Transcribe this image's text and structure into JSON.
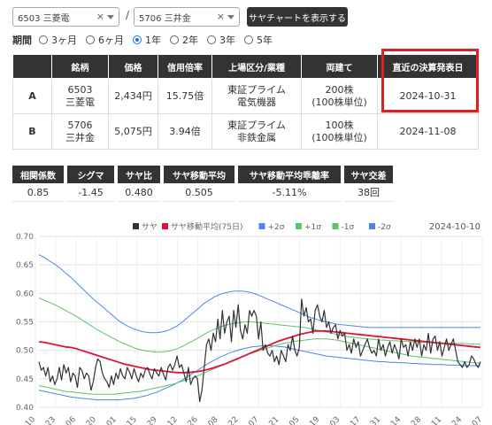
{
  "header": {
    "stock1": "6503 三菱電",
    "stock2": "5706 三井金",
    "slash": "/",
    "clear_icon": "×",
    "show_button": "サヤチャートを表示する"
  },
  "period": {
    "label": "期間",
    "options": [
      "3ヶ月",
      "6ヶ月",
      "1年",
      "2年",
      "3年",
      "5年"
    ],
    "selected": "1年"
  },
  "stock_table": {
    "headers": [
      "",
      "銘柄",
      "価格",
      "信用倍率",
      "上場区分/業種",
      "両建て",
      "直近の決算発表日"
    ],
    "rows": [
      {
        "id": "A",
        "name1": "6503",
        "name2": "三菱電",
        "price": "2,434円",
        "margin": "15.75倍",
        "market1": "東証プライム",
        "market2": "電気機器",
        "unit1": "200株",
        "unit2": "(100株単位)",
        "earnings": "2024-10-31"
      },
      {
        "id": "B",
        "name1": "5706",
        "name2": "三井金",
        "price": "5,075円",
        "margin": "3.94倍",
        "market1": "東証プライム",
        "market2": "非鉄金属",
        "unit1": "100株",
        "unit2": "(100株単位)",
        "earnings": "2024-11-08"
      }
    ]
  },
  "stats": {
    "headers": [
      "相関係数",
      "シグマ",
      "サヤ比",
      "サヤ移動平均",
      "サヤ移動平均乖離率",
      "サヤ交差"
    ],
    "values": [
      "0.85",
      "-1.45",
      "0.480",
      "0.505",
      "-5.11%",
      "38回"
    ]
  },
  "colors": {
    "saya": "#333333",
    "ma": "#e0103a",
    "sigma2": "#4d84f0",
    "sigma1": "#5cc46a",
    "highlight": "#e02020",
    "header_bg": "#333333"
  },
  "chart_data": {
    "type": "line",
    "date_label": "2024-10-10",
    "legend": [
      "サヤ",
      "サヤ移動平均(75日)",
      "+2σ",
      "+1σ",
      "-1σ",
      "-2σ"
    ],
    "ylim": [
      0.4,
      0.7
    ],
    "yticks": [
      "0.70",
      "0.65",
      "0.60",
      "0.55",
      "0.50",
      "0.45",
      "0.40"
    ],
    "xticks": [
      "10",
      "23",
      "06",
      "20",
      "01",
      "15",
      "29",
      "12",
      "26",
      "08",
      "22",
      "07",
      "21",
      "05",
      "19",
      "03",
      "17",
      "31",
      "14",
      "28",
      "11",
      "24",
      "07"
    ],
    "series": [
      {
        "name": "サヤ",
        "values": [
          0.48,
          0.465,
          0.47,
          0.455,
          0.47,
          0.445,
          0.455,
          0.44,
          0.45,
          0.47,
          0.448,
          0.475,
          0.46,
          0.47,
          0.445,
          0.46,
          0.455,
          0.435,
          0.47,
          0.465,
          0.45,
          0.46,
          0.455,
          0.43,
          0.445,
          0.47,
          0.485,
          0.48,
          0.46,
          0.45,
          0.445,
          0.435,
          0.455,
          0.44,
          0.46,
          0.45,
          0.468,
          0.455,
          0.45,
          0.47,
          0.462,
          0.45,
          0.468,
          0.455,
          0.445,
          0.46,
          0.452,
          0.466,
          0.47,
          0.458,
          0.45,
          0.468,
          0.46,
          0.455,
          0.47,
          0.458,
          0.448,
          0.47,
          0.476,
          0.465,
          0.475,
          0.49,
          0.47,
          0.475,
          0.46,
          0.445,
          0.47,
          0.44,
          0.45,
          0.455,
          0.45,
          0.41,
          0.43,
          0.47,
          0.51,
          0.52,
          0.5,
          0.53,
          0.515,
          0.555,
          0.52,
          0.57,
          0.53,
          0.55,
          0.56,
          0.515,
          0.57,
          0.54,
          0.58,
          0.535,
          0.52,
          0.545,
          0.53,
          0.57,
          0.56,
          0.57,
          0.56,
          0.52,
          0.55,
          0.5,
          0.51,
          0.495,
          0.49,
          0.5,
          0.48,
          0.49,
          0.475,
          0.5,
          0.49,
          0.48,
          0.51,
          0.5,
          0.525,
          0.5,
          0.49,
          0.505,
          0.59,
          0.56,
          0.575,
          0.55,
          0.555,
          0.53,
          0.57,
          0.58,
          0.56,
          0.55,
          0.57,
          0.54,
          0.55,
          0.53,
          0.54,
          0.545,
          0.52,
          0.535,
          0.525,
          0.53,
          0.5,
          0.51,
          0.495,
          0.52,
          0.505,
          0.515,
          0.49,
          0.5,
          0.51,
          0.52,
          0.505,
          0.495,
          0.5,
          0.49,
          0.52,
          0.5,
          0.51,
          0.49,
          0.505,
          0.515,
          0.495,
          0.51,
          0.5,
          0.485,
          0.52,
          0.505,
          0.51,
          0.49,
          0.515,
          0.5,
          0.52,
          0.505,
          0.52,
          0.49,
          0.51,
          0.5,
          0.53,
          0.495,
          0.52,
          0.525,
          0.5,
          0.515,
          0.49,
          0.505,
          0.52,
          0.5,
          0.51,
          0.52,
          0.5,
          0.48,
          0.475,
          0.47,
          0.48,
          0.47,
          0.475,
          0.49,
          0.485,
          0.475,
          0.47,
          0.48
        ]
      },
      {
        "name": "サヤ移動平均(75日)",
        "values": [
          0.515,
          0.514,
          0.512,
          0.51,
          0.508,
          0.506,
          0.505,
          0.503,
          0.5,
          0.497,
          0.494,
          0.491,
          0.488,
          0.485,
          0.482,
          0.479,
          0.476,
          0.474,
          0.472,
          0.47,
          0.468,
          0.466,
          0.465,
          0.464,
          0.463,
          0.462,
          0.461,
          0.461,
          0.461,
          0.462,
          0.463,
          0.465,
          0.467,
          0.47,
          0.473,
          0.476,
          0.48,
          0.484,
          0.488,
          0.492,
          0.496,
          0.5,
          0.504,
          0.508,
          0.512,
          0.516,
          0.519,
          0.522,
          0.525,
          0.528,
          0.53,
          0.532,
          0.534,
          0.534,
          0.534,
          0.533,
          0.532,
          0.531,
          0.53,
          0.529,
          0.528,
          0.527,
          0.526,
          0.525,
          0.524,
          0.523,
          0.522,
          0.521,
          0.52,
          0.519,
          0.518,
          0.517,
          0.516,
          0.515,
          0.514,
          0.513,
          0.512,
          0.511,
          0.51,
          0.509,
          0.508,
          0.507,
          0.506,
          0.505
        ]
      },
      {
        "name": "+2σ",
        "values": [
          0.668,
          0.663,
          0.657,
          0.651,
          0.644,
          0.636,
          0.628,
          0.619,
          0.61,
          0.601,
          0.592,
          0.584,
          0.576,
          0.568,
          0.56,
          0.552,
          0.546,
          0.541,
          0.537,
          0.534,
          0.532,
          0.531,
          0.531,
          0.532,
          0.534,
          0.538,
          0.543,
          0.55,
          0.558,
          0.566,
          0.574,
          0.582,
          0.588,
          0.594,
          0.598,
          0.601,
          0.603,
          0.604,
          0.604,
          0.603,
          0.601,
          0.598,
          0.594,
          0.59,
          0.586,
          0.582,
          0.578,
          0.574,
          0.57,
          0.566,
          0.562,
          0.558,
          0.555,
          0.552,
          0.55,
          0.548,
          0.546,
          0.545,
          0.544,
          0.543,
          0.542,
          0.541,
          0.54,
          0.54,
          0.54,
          0.54,
          0.54,
          0.54,
          0.54,
          0.54,
          0.54,
          0.54,
          0.54,
          0.54,
          0.54,
          0.54,
          0.54,
          0.54,
          0.54,
          0.54,
          0.54,
          0.54,
          0.54,
          0.54
        ]
      },
      {
        "name": "+1σ",
        "values": [
          0.592,
          0.588,
          0.584,
          0.58,
          0.575,
          0.57,
          0.565,
          0.56,
          0.554,
          0.548,
          0.542,
          0.536,
          0.531,
          0.526,
          0.521,
          0.516,
          0.512,
          0.508,
          0.504,
          0.501,
          0.499,
          0.498,
          0.497,
          0.497,
          0.498,
          0.5,
          0.503,
          0.507,
          0.512,
          0.517,
          0.522,
          0.528,
          0.533,
          0.537,
          0.541,
          0.544,
          0.546,
          0.548,
          0.549,
          0.55,
          0.55,
          0.549,
          0.548,
          0.547,
          0.546,
          0.545,
          0.544,
          0.543,
          0.542,
          0.541,
          0.54,
          0.538,
          0.536,
          0.534,
          0.532,
          0.53,
          0.528,
          0.526,
          0.524,
          0.523,
          0.522,
          0.521,
          0.52,
          0.519,
          0.518,
          0.518,
          0.517,
          0.517,
          0.516,
          0.516,
          0.515,
          0.515,
          0.514,
          0.514,
          0.514,
          0.513,
          0.513,
          0.513,
          0.512,
          0.512,
          0.512,
          0.511,
          0.511,
          0.511
        ]
      },
      {
        "name": "-1σ",
        "values": [
          0.438,
          0.436,
          0.434,
          0.432,
          0.43,
          0.428,
          0.427,
          0.426,
          0.425,
          0.424,
          0.423,
          0.423,
          0.423,
          0.423,
          0.423,
          0.424,
          0.425,
          0.426,
          0.427,
          0.428,
          0.43,
          0.432,
          0.434,
          0.436,
          0.438,
          0.44,
          0.443,
          0.446,
          0.449,
          0.452,
          0.456,
          0.46,
          0.464,
          0.468,
          0.472,
          0.476,
          0.48,
          0.484,
          0.488,
          0.492,
          0.495,
          0.498,
          0.501,
          0.504,
          0.507,
          0.51,
          0.512,
          0.514,
          0.516,
          0.517,
          0.518,
          0.519,
          0.52,
          0.52,
          0.52,
          0.519,
          0.518,
          0.516,
          0.514,
          0.512,
          0.51,
          0.508,
          0.506,
          0.504,
          0.502,
          0.5,
          0.498,
          0.496,
          0.494,
          0.492,
          0.49,
          0.489,
          0.488,
          0.487,
          0.486,
          0.485,
          0.484,
          0.483,
          0.482,
          0.481,
          0.48,
          0.479,
          0.478,
          0.477
        ]
      },
      {
        "name": "-2σ",
        "values": [
          0.43,
          0.428,
          0.426,
          0.424,
          0.422,
          0.42,
          0.418,
          0.417,
          0.416,
          0.415,
          0.414,
          0.413,
          0.413,
          0.413,
          0.413,
          0.413,
          0.414,
          0.415,
          0.416,
          0.418,
          0.42,
          0.423,
          0.426,
          0.43,
          0.434,
          0.438,
          0.443,
          0.448,
          0.454,
          0.46,
          0.466,
          0.472,
          0.478,
          0.483,
          0.488,
          0.492,
          0.496,
          0.499,
          0.502,
          0.504,
          0.506,
          0.507,
          0.508,
          0.508,
          0.508,
          0.507,
          0.506,
          0.504,
          0.502,
          0.5,
          0.498,
          0.496,
          0.494,
          0.492,
          0.49,
          0.489,
          0.488,
          0.487,
          0.486,
          0.485,
          0.484,
          0.483,
          0.482,
          0.481,
          0.48,
          0.48,
          0.479,
          0.479,
          0.478,
          0.478,
          0.477,
          0.477,
          0.476,
          0.476,
          0.475,
          0.475,
          0.475,
          0.474,
          0.474,
          0.474,
          0.473,
          0.473,
          0.473,
          0.473
        ]
      }
    ]
  }
}
